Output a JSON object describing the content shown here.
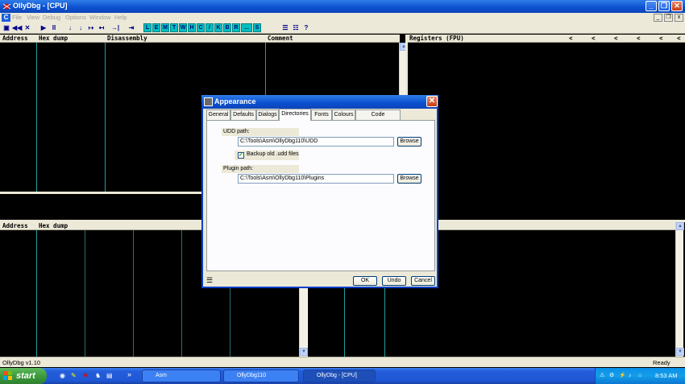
{
  "window": {
    "title": "OllyDbg - [CPU]",
    "minimize": "_",
    "restore": "❐",
    "close": "✕"
  },
  "menu": {
    "items": [
      "File",
      "View",
      "Debug",
      "Options",
      "Window",
      "Help"
    ],
    "mdi_minimize": "_",
    "mdi_restore": "❐",
    "mdi_close": "x"
  },
  "toolbar": {
    "nav_buttons": [
      "◀◀",
      "◀",
      "■",
      "▶",
      "II"
    ],
    "trace_buttons": [
      "↓",
      "↓",
      "↦",
      "↤",
      "→|"
    ],
    "window_buttons": [
      "L",
      "E",
      "M",
      "T",
      "W",
      "H",
      "C",
      "/",
      "K",
      "B",
      "R",
      "...",
      "S"
    ],
    "right_buttons": [
      "☰",
      "☷",
      "?"
    ]
  },
  "cpu": {
    "disasm_headers": {
      "address": "Address",
      "hex": "Hex dump",
      "disasm": "Disassembly",
      "comment": "Comment"
    },
    "registers_header": "Registers (FPU)",
    "reg_arrows": [
      "<",
      "<",
      "<",
      "<",
      "<",
      "<"
    ],
    "dump_headers": {
      "address": "Address",
      "hex": "Hex dump"
    }
  },
  "dialog": {
    "title": "Appearance",
    "close": "✕",
    "tabs": [
      "General",
      "Defaults",
      "Dialogs",
      "Directories",
      "Fonts",
      "Colours",
      "Code highlighting"
    ],
    "active_tab": "Directories",
    "udd_label": "UDD path:",
    "udd_value": "C:\\Tools\\Asm\\OllyDbg110\\UDD",
    "browse1": "Browse",
    "backup_label": "Backup old .udd files",
    "backup_checked": true,
    "plugin_label": "Plugin path:",
    "plugin_value": "C:\\Tools\\Asm\\OllyDbg110\\Plugins",
    "browse2": "Browse",
    "ok": "OK",
    "undo": "Undo",
    "cancel": "Cancel"
  },
  "status": {
    "left": "OllyDbg v1.10",
    "right": "Ready"
  },
  "taskbar": {
    "start": "start",
    "quick_chevron": "»",
    "tasks": [
      {
        "label": "Asm",
        "active": false
      },
      {
        "label": "OllyDbg110",
        "active": false
      },
      {
        "label": "OllyDbg - [CPU]",
        "active": true
      }
    ],
    "clock": "8:53 AM"
  },
  "colors": {
    "grid_line": "#1f9fa0",
    "pane_bg": "#000000",
    "titlebar": "#0a4fcf"
  }
}
